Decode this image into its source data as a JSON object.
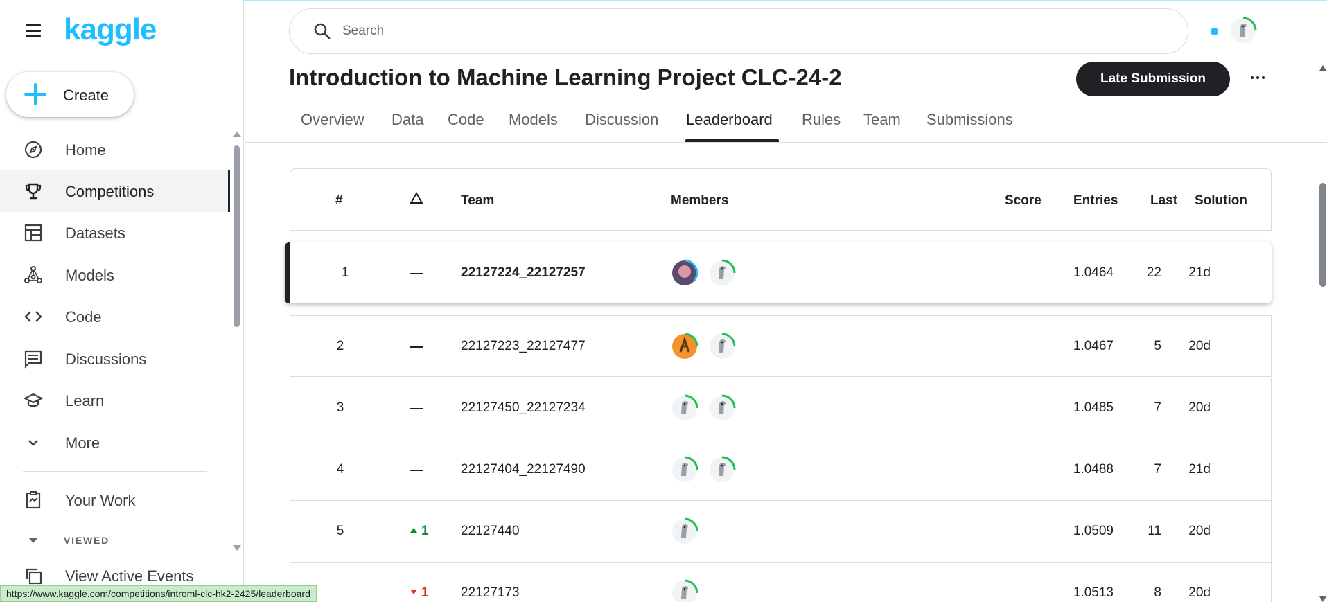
{
  "brand": {
    "logo_text": "kaggle"
  },
  "sidebar": {
    "create_label": "Create",
    "items": [
      {
        "label": "Home",
        "icon": "compass-icon"
      },
      {
        "label": "Competitions",
        "icon": "trophy-icon"
      },
      {
        "label": "Datasets",
        "icon": "table-icon"
      },
      {
        "label": "Models",
        "icon": "model-nodes-icon"
      },
      {
        "label": "Code",
        "icon": "code-brackets-icon"
      },
      {
        "label": "Discussions",
        "icon": "comments-icon"
      },
      {
        "label": "Learn",
        "icon": "graduation-cap-icon"
      },
      {
        "label": "More",
        "icon": "chevron-down-icon"
      },
      {
        "label": "Your Work",
        "icon": "clipboard-icon"
      },
      {
        "label": "View Active Events",
        "icon": "copy-stack-icon"
      }
    ],
    "active_item": "Competitions",
    "viewed_label": "VIEWED"
  },
  "search": {
    "placeholder": "Search",
    "value": ""
  },
  "competition": {
    "title": "Introduction to Machine Learning Project CLC-24-2",
    "late_submission_label": "Late Submission",
    "more_label": "⋯",
    "tabs": [
      "Overview",
      "Data",
      "Code",
      "Models",
      "Discussion",
      "Leaderboard",
      "Rules",
      "Team",
      "Submissions"
    ],
    "active_tab": "Leaderboard"
  },
  "leaderboard": {
    "columns": {
      "rank": "#",
      "change": "△",
      "team": "Team",
      "members": "Members",
      "score": "Score",
      "entries": "Entries",
      "last": "Last",
      "solution": "Solution"
    },
    "rows": [
      {
        "rank": "1",
        "change": "—",
        "team": "22127224_22127257",
        "members": [
          "photo-avatar",
          "default-avatar"
        ],
        "score": "1.0464",
        "entries": "22",
        "last": "21d"
      },
      {
        "rank": "2",
        "change": "—",
        "team": "22127223_22127477",
        "members": [
          "orange-avatar",
          "default-avatar"
        ],
        "score": "1.0467",
        "entries": "5",
        "last": "20d"
      },
      {
        "rank": "3",
        "change": "—",
        "team": "22127450_22127234",
        "members": [
          "default-avatar",
          "default-avatar"
        ],
        "score": "1.0485",
        "entries": "7",
        "last": "20d"
      },
      {
        "rank": "4",
        "change": "—",
        "team": "22127404_22127490",
        "members": [
          "default-avatar",
          "default-avatar"
        ],
        "score": "1.0488",
        "entries": "7",
        "last": "21d"
      },
      {
        "rank": "5",
        "change": "1",
        "change_dir": "up",
        "team": "22127440",
        "members": [
          "default-avatar"
        ],
        "score": "1.0509",
        "entries": "11",
        "last": "20d"
      },
      {
        "rank": "",
        "change": "1",
        "change_dir": "down",
        "team": "22127173",
        "members": [
          "default-avatar"
        ],
        "score": "1.0513",
        "entries": "8",
        "last": "20d"
      }
    ]
  },
  "status_bar": {
    "url": "https://www.kaggle.com/competitions/introml-clc-hk2-2425/leaderboard"
  },
  "colors": {
    "accent": "#20beff",
    "dark": "#202124",
    "up": "#0d8a3a",
    "down": "#d93025",
    "progress_ring": "#20c157"
  }
}
